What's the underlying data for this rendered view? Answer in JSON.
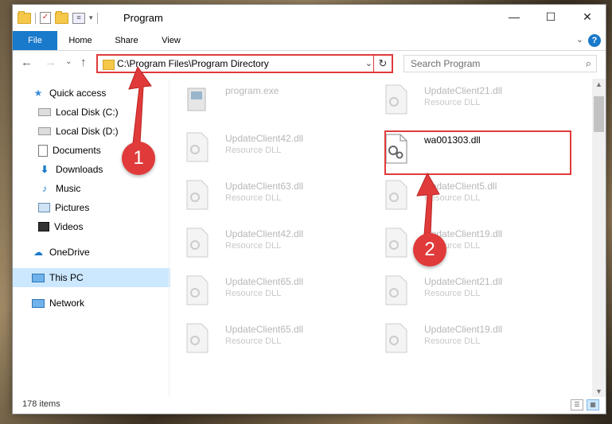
{
  "window": {
    "title": "Program",
    "controls": {
      "minimize": "—",
      "maximize": "☐",
      "close": "✕"
    }
  },
  "ribbon": {
    "tabs": [
      "File",
      "Home",
      "Share",
      "View"
    ],
    "help": "?"
  },
  "navigation": {
    "back": "←",
    "forward": "→",
    "recent": "⌄",
    "up": "↑",
    "address": "C:\\Program Files\\Program Directory",
    "search_placeholder": "Search Program"
  },
  "nav_pane": {
    "items": [
      {
        "label": "Quick access",
        "icon": "star-icon",
        "pinned": false
      },
      {
        "label": "Local Disk (C:)",
        "icon": "drive-icon",
        "pinned": true
      },
      {
        "label": "Local Disk (D:)",
        "icon": "drive-icon",
        "pinned": true
      },
      {
        "label": "Documents",
        "icon": "documents-icon",
        "pinned": true
      },
      {
        "label": "Downloads",
        "icon": "downloads-icon",
        "pinned": true
      },
      {
        "label": "Music",
        "icon": "music-icon",
        "pinned": true
      },
      {
        "label": "Pictures",
        "icon": "pictures-icon",
        "pinned": true
      },
      {
        "label": "Videos",
        "icon": "videos-icon",
        "pinned": true
      },
      {
        "label": "OneDrive",
        "icon": "onedrive-icon",
        "pinned": false
      },
      {
        "label": "This PC",
        "icon": "pc-icon",
        "pinned": false,
        "selected": true
      },
      {
        "label": "Network",
        "icon": "network-icon",
        "pinned": false
      }
    ]
  },
  "files": [
    {
      "name": "program.exe",
      "type": "",
      "active": false
    },
    {
      "name": "UpdateClient21.dll",
      "type": "Resource DLL",
      "active": false
    },
    {
      "name": "UpdateClient42.dll",
      "type": "Resource DLL",
      "active": false
    },
    {
      "name": "wa001303.dll",
      "type": "",
      "active": true
    },
    {
      "name": "UpdateClient63.dll",
      "type": "Resource DLL",
      "active": false
    },
    {
      "name": "UpdateClient5.dll",
      "type": "Resource DLL",
      "active": false
    },
    {
      "name": "UpdateClient42.dll",
      "type": "Resource DLL",
      "active": false
    },
    {
      "name": "UpdateClient19.dll",
      "type": "Resource DLL",
      "active": false
    },
    {
      "name": "UpdateClient65.dll",
      "type": "Resource DLL",
      "active": false
    },
    {
      "name": "UpdateClient21.dll",
      "type": "Resource DLL",
      "active": false
    },
    {
      "name": "UpdateClient65.dll",
      "type": "Resource DLL",
      "active": false
    },
    {
      "name": "UpdateClient19.dll",
      "type": "Resource DLL",
      "active": false
    }
  ],
  "status": {
    "item_count": "178 items"
  },
  "annotations": {
    "step1": "1",
    "step2": "2"
  },
  "colors": {
    "accent": "#1979ca",
    "highlight": "#e03a3a",
    "selected_bg": "#cce8ff"
  }
}
